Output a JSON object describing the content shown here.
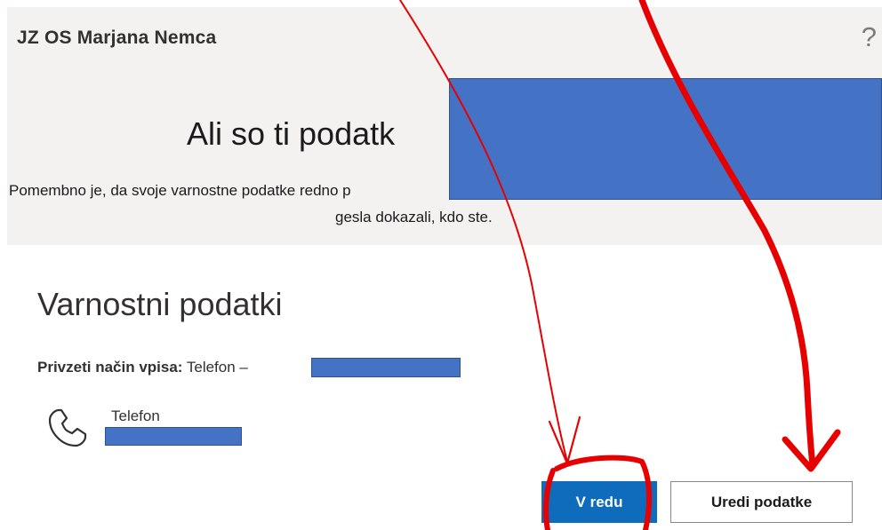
{
  "header": {
    "org_name": "JZ OS Marjana Nemca",
    "help_glyph": "?"
  },
  "banner": {
    "title": "Ali so ti podatk",
    "description_line1": "Pomembno je, da svoje varnostne podatke redno p",
    "description_line2": "gesla dokazali, kdo ste."
  },
  "security_info": {
    "title": "Varnostni podatki",
    "default_method_label": "Privzeti način vpisa:",
    "default_method_value": "Telefon – ",
    "method_name": "Telefon",
    "method_icon": "phone-icon"
  },
  "actions": {
    "ok_label": "V redu",
    "edit_label": "Uredi podatke"
  },
  "colors": {
    "primary": "#0f6cbd",
    "redaction": "#4472c4",
    "annotation": "#e60000",
    "header_bg": "#f3f2f1"
  }
}
